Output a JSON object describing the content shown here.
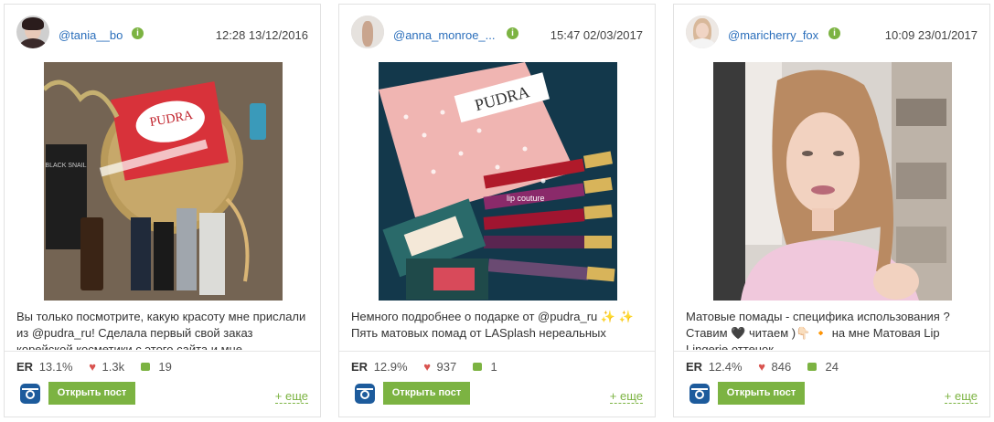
{
  "posts": [
    {
      "username": "@tania__bo",
      "datetime": "12:28 13/12/2016",
      "caption": "Вы только посмотрите, какую красоту мне прислали из @pudra_ru! Сделала первый свой заказ корейской косметики с этого сайта и мне",
      "er_label": "ER",
      "er_value": "13.1%",
      "likes": "1.3k",
      "comments": "19",
      "open_label": "Открыть пост",
      "more_label": "+ еще",
      "photo_brand": "PUDRA",
      "photo_product": "BLACK SNAIL"
    },
    {
      "username": "@anna_monroe_...",
      "datetime": "15:47 02/03/2017",
      "caption": "Немного подробнее о подарке от @pudra_ru ✨ ✨ Пять матовых помад от LASplash нереальных",
      "er_label": "ER",
      "er_value": "12.9%",
      "likes": "937",
      "comments": "1",
      "open_label": "Открыть пост",
      "more_label": "+ еще",
      "photo_brand": "PUDRA",
      "photo_product": "lip couture"
    },
    {
      "username": "@maricherry_fox",
      "datetime": "10:09 23/01/2017",
      "caption": "Матовые помады - специфика использования ? Ставим 🖤 читаем )👇🏻 🔸 на мне Матовая Lip Lingerie оттенок",
      "er_label": "ER",
      "er_value": "12.4%",
      "likes": "846",
      "comments": "24",
      "open_label": "Открыть пост",
      "more_label": "+ еще"
    }
  ],
  "colors": {
    "accent_green": "#7cb342",
    "link_blue": "#2a6ebb",
    "heart_red": "#d9534f",
    "instagram_blue": "#1d5b9c"
  },
  "icons": [
    "verified-icon",
    "heart-icon",
    "comment-icon",
    "instagram-icon"
  ]
}
